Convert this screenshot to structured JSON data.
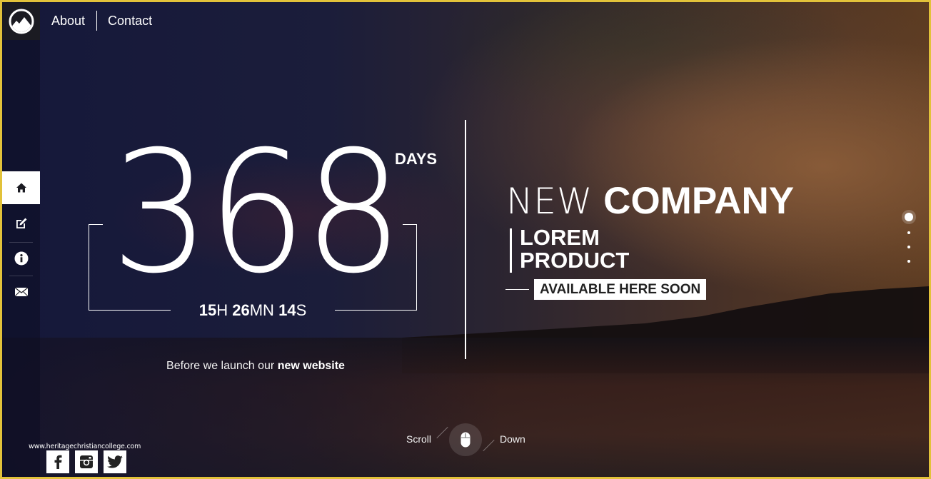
{
  "brand": {
    "logo_icon": "mountain-circle-logo"
  },
  "topnav": {
    "items": [
      {
        "label": "About"
      },
      {
        "label": "Contact"
      }
    ]
  },
  "sidebar": {
    "items": [
      {
        "icon": "home-icon",
        "active": true
      },
      {
        "icon": "edit-icon",
        "active": false
      },
      {
        "icon": "info-icon",
        "active": false
      },
      {
        "icon": "mail-icon",
        "active": false
      }
    ]
  },
  "countdown": {
    "days": "368",
    "days_label": "DAYS",
    "hours": "15",
    "hours_unit": "H",
    "minutes": "26",
    "minutes_unit": "MN",
    "seconds": "14",
    "seconds_unit": "S",
    "caption_prefix": "Before we launch our ",
    "caption_bold": "new website"
  },
  "hero": {
    "title_thin": "NEW",
    "title_bold": "COMPANY",
    "subtitle_line1": "LOREM",
    "subtitle_line2": "PRODUCT",
    "badge": "AVAILABLE HERE SOON"
  },
  "pager": {
    "count": 4,
    "active_index": 0
  },
  "scroll": {
    "left_label": "Scroll",
    "right_label": "Down",
    "icon": "mouse-icon"
  },
  "footer": {
    "url": "www.heritagechristiancollege.com",
    "social": [
      {
        "name": "facebook"
      },
      {
        "name": "instagram"
      },
      {
        "name": "twitter"
      }
    ]
  },
  "colors": {
    "frame_border": "#e2c23a",
    "text": "#ffffff",
    "badge_text": "#222222"
  }
}
